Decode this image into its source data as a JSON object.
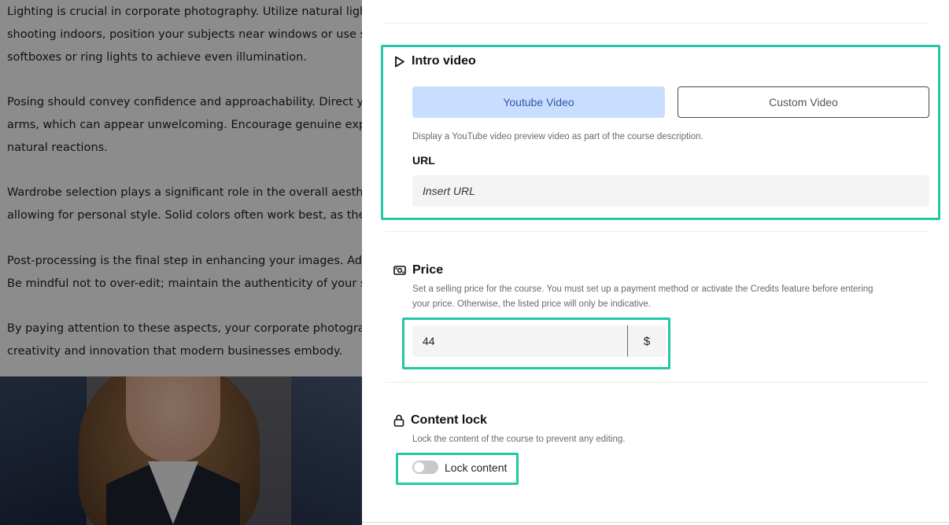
{
  "background": {
    "paragraphs": [
      [
        "Lighting is crucial in corporate photography. Utilize natural light w",
        "shooting indoors, position your subjects near windows or use soft",
        "softboxes or ring lights to achieve even illumination."
      ],
      [
        "Posing should convey confidence and approachability. Direct your",
        "arms, which can appear unwelcoming. Encourage genuine express",
        "natural reactions."
      ],
      [
        "Wardrobe selection plays a significant role in the overall aesthetic",
        "allowing for personal style. Solid colors often work best, as they a"
      ],
      [
        "Post-processing is the final step in enhancing your images. Adjust",
        "Be mindful not to over-edit; maintain the authenticity of your sub"
      ],
      [
        "By paying attention to these aspects, your corporate photography",
        "creativity and innovation that modern businesses embody."
      ]
    ]
  },
  "intro_video": {
    "title": "Intro video",
    "tab_youtube": "Youtube Video",
    "tab_custom": "Custom Video",
    "selected_tab": "Youtube Video",
    "helper": "Display a YouTube video preview video as part of the course description.",
    "url_label": "URL",
    "url_placeholder": "Insert URL",
    "url_value": ""
  },
  "price": {
    "title": "Price",
    "helper_line1": "Set a selling price for the course. You must set up a payment method or activate the Credits feature before entering",
    "helper_line2": "your price. Otherwise, the listed price will only be indicative.",
    "value": "44",
    "currency": "$"
  },
  "content_lock": {
    "title": "Content lock",
    "helper": "Lock the content of the course to prevent any editing.",
    "toggle_label": "Lock content",
    "enabled": false
  },
  "colors": {
    "highlight": "#22c9a4",
    "tab_selected_bg": "#c9deff",
    "tab_selected_text": "#2f57a8"
  }
}
